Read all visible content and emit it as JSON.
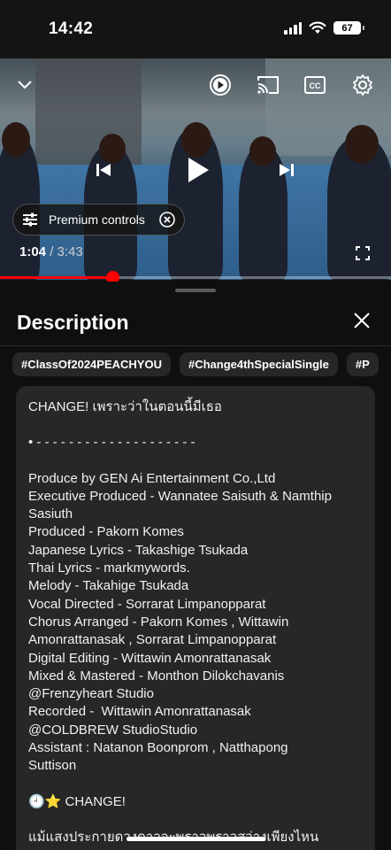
{
  "status_bar": {
    "time": "14:42",
    "battery": "67"
  },
  "player": {
    "premium_controls_label": "Premium controls",
    "current_time": "1:04",
    "separator": " / ",
    "duration": "3:43",
    "progress_fraction": 0.287
  },
  "panel": {
    "title": "Description",
    "chips": [
      "#ClassOf2024PEACHYOU",
      "#Change4thSpecialSingle",
      "#P"
    ]
  },
  "description": {
    "lines": [
      "CHANGE! เพราะว่าในตอนนี้มีเธอ",
      "",
      "• - - - - - - - - - - - - - - - - - - - -",
      "",
      "Produce by GEN Ai Entertainment Co.,Ltd",
      "Executive Produced - Wannatee Saisuth & Namthip",
      "Sasiuth",
      "Produced - Pakorn Komes",
      "Japanese Lyrics - Takashige Tsukada",
      "Thai Lyrics - markmywords.",
      "Melody - Takahige Tsukada",
      "Vocal Directed - Sorrarat Limpanopparat",
      "Chorus Arranged - Pakorn Komes , Wittawin",
      "Amonrattanasak , Sorrarat Limpanopparat",
      "Digital Editing - Wittawin Amonrattanasak",
      "Mixed & Mastered - Monthon Dilokchavanis",
      "@Frenzyheart Studio",
      "Recorded -  Wittawin Amonrattanasak",
      "@COLDBREW StudioStudio",
      "Assistant : Natanon Boonprom , Natthapong",
      "Suttison",
      "",
      "🕘⭐ CHANGE!",
      "",
      "แม้แสงประกายดวงดาวจะพราวพราวสว่างเพียงไหน"
    ]
  },
  "icons": {
    "collapse": "chevron-down-icon",
    "autoplay": "autoplay-icon",
    "cast": "cast-icon",
    "captions": "captions-icon",
    "settings": "gear-icon",
    "previous": "skip-previous-icon",
    "play": "play-icon",
    "next": "skip-next-icon",
    "premium": "sliders-icon",
    "premium_close": "close-circle-icon",
    "fullscreen": "fullscreen-icon",
    "close": "close-icon"
  }
}
